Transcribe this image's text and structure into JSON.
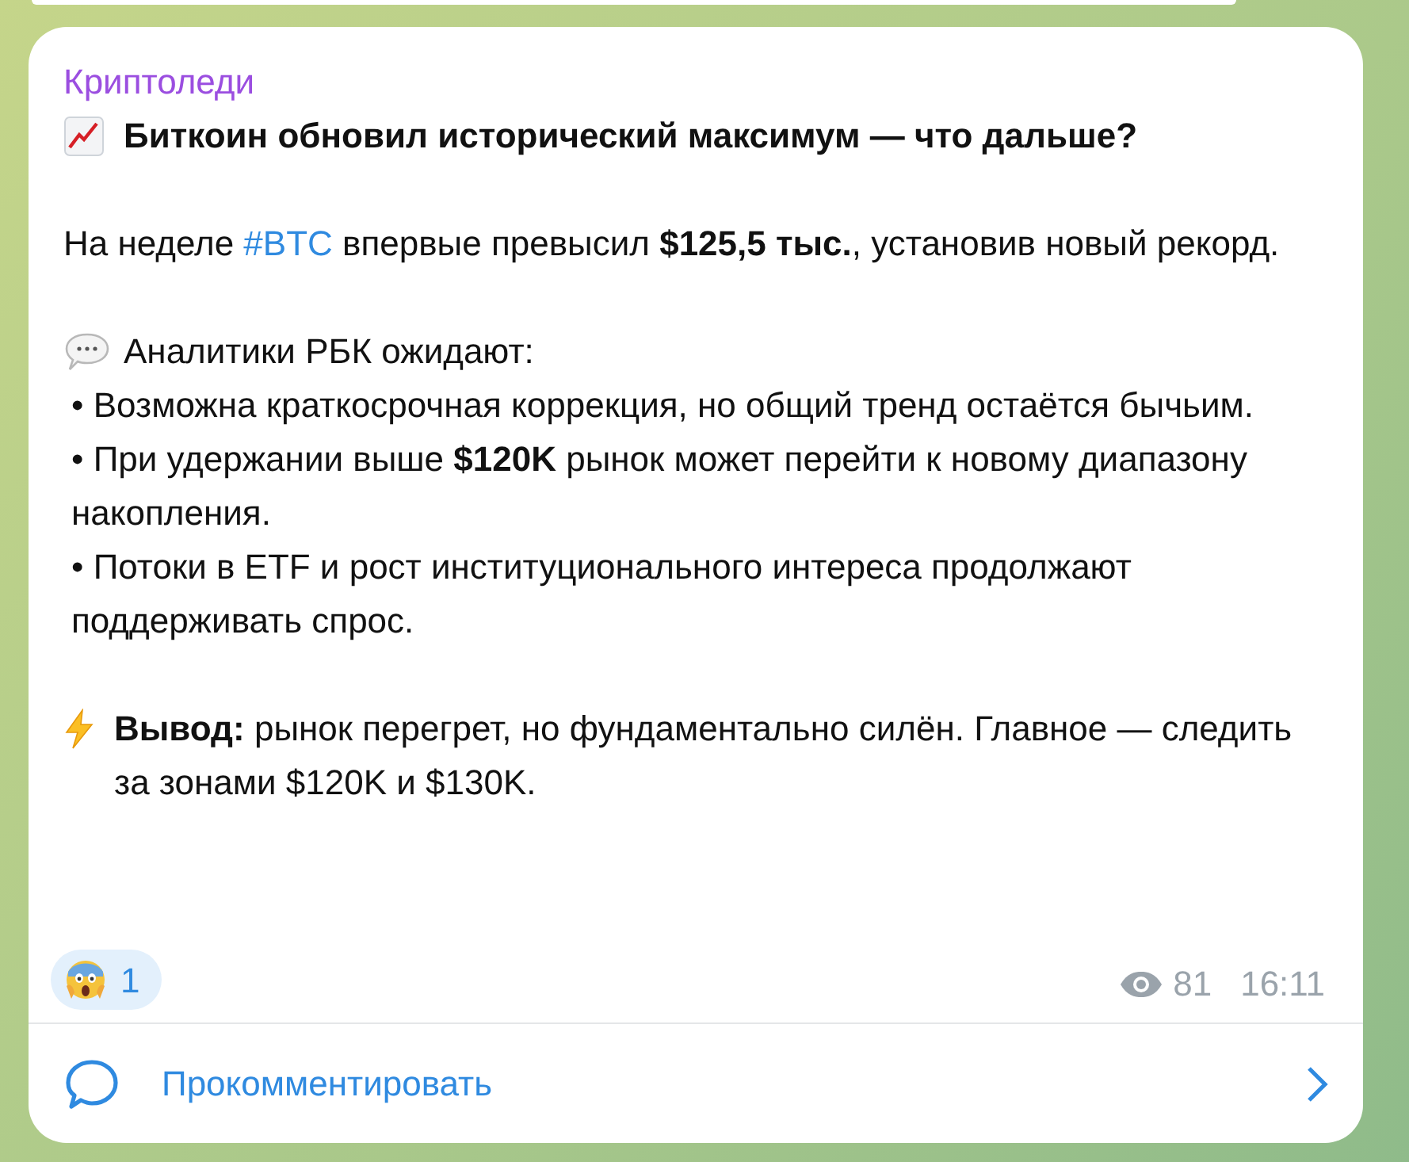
{
  "channel": {
    "name": "Криптоледи"
  },
  "post": {
    "title": "Биткоин обновил исторический максимум — что дальше?",
    "intro": {
      "before": "На неделе ",
      "hashtag": "#BTC",
      "after": " впервые превысил **$125,5 тыс.**, установив новый рекорд."
    },
    "analysts_heading": "Аналитики РБК ожидают:",
    "bullets": [
      "• Возможна краткосрочная коррекция, но общий тренд остаётся бычьим.",
      "• При удержании выше **$120K** рынок может перейти к новому диапазону накопления.",
      "• Потоки в ETF и рост институционального интереса продолжают поддерживать спрос."
    ],
    "conclusion": "**Вывод:** рынок перегрет, но фундаментально силён. Главное — следить за зонами $120K и $130K."
  },
  "reactions": [
    {
      "count": "1"
    }
  ],
  "views": "81",
  "time": "16:11",
  "comment_button": "Прокомментировать"
}
